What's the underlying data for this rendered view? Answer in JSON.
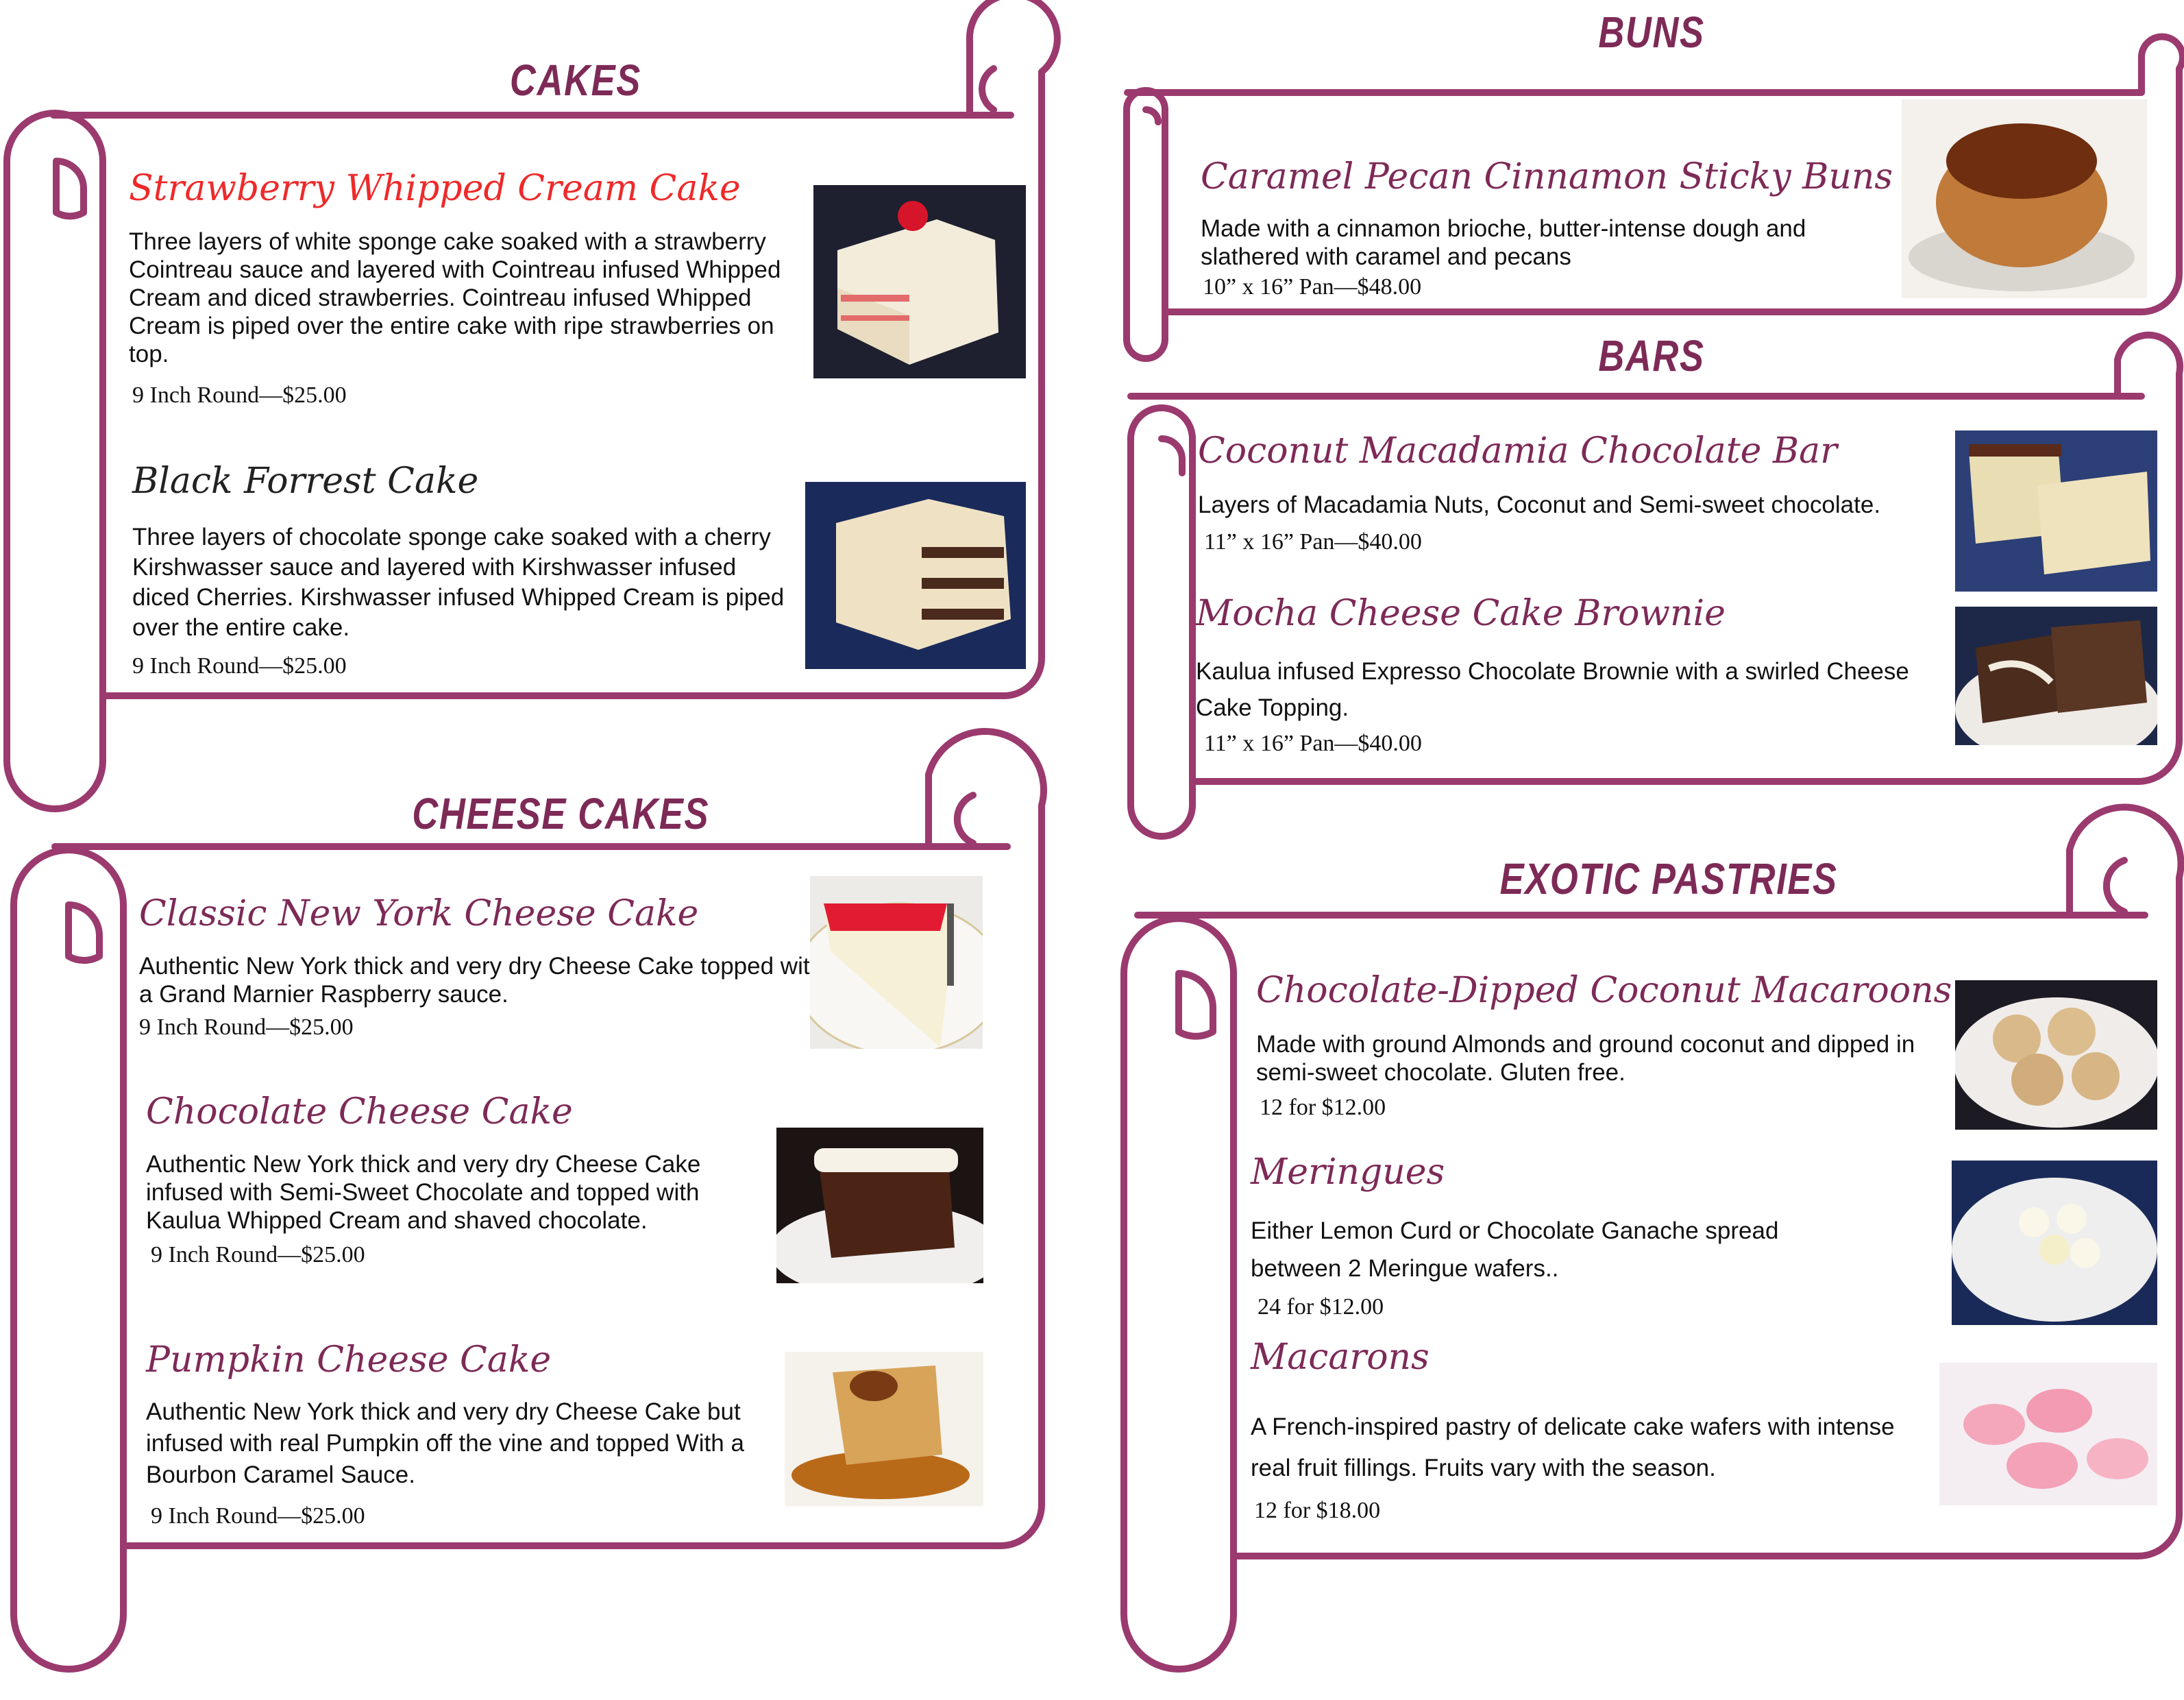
{
  "sections": {
    "cakes": {
      "title": "CAKES",
      "items": [
        {
          "name": "Strawberry Whipped Cream Cake",
          "description": "Three layers of white sponge cake soaked with a strawberry Cointreau sauce and layered with Cointreau infused Whipped Cream and diced strawberries. Cointreau infused Whipped Cream is piped over the entire cake with ripe strawberries on top.",
          "price": "9 Inch Round—$25.00"
        },
        {
          "name": "Black Forrest Cake",
          "description": "Three layers of chocolate sponge cake soaked with a cherry Kirshwasser sauce and layered with Kirshwasser infused diced Cherries. Kirshwasser infused Whipped Cream is piped over the entire cake.",
          "price": "9 Inch Round—$25.00"
        }
      ]
    },
    "cheese_cakes": {
      "title": "CHEESE CAKES",
      "items": [
        {
          "name": "Classic New York Cheese Cake",
          "description": "Authentic  New York thick and very dry Cheese Cake topped with a Grand Marnier Raspberry sauce.",
          "price": "9 Inch Round—$25.00"
        },
        {
          "name": "Chocolate Cheese Cake",
          "description": "Authentic  New York thick and very dry Cheese Cake infused with Semi-Sweet Chocolate and topped with Kaulua Whipped Cream and shaved chocolate.",
          "price": "9 Inch Round—$25.00"
        },
        {
          "name": "Pumpkin Cheese Cake",
          "description": "Authentic  New York thick and very dry Cheese Cake but infused with real Pumpkin off the vine and topped With a Bourbon Caramel Sauce.",
          "price": "9 Inch Round—$25.00"
        }
      ]
    },
    "buns": {
      "title": "BUNS",
      "items": [
        {
          "name": "Caramel Pecan Cinnamon Sticky Buns",
          "description": "Made with a cinnamon brioche, butter-intense dough and slathered with caramel and pecans",
          "price": "10” x 16” Pan—$48.00"
        }
      ]
    },
    "bars": {
      "title": "BARS",
      "items": [
        {
          "name": "Coconut Macadamia Chocolate Bar",
          "description": "Layers of Macadamia Nuts, Coconut and Semi-sweet chocolate.",
          "price": "11” x 16” Pan—$40.00"
        },
        {
          "name": "Mocha Cheese Cake Brownie",
          "description": "Kaulua infused Expresso Chocolate Brownie with a swirled Cheese Cake Topping.",
          "price": "11” x 16” Pan—$40.00"
        }
      ]
    },
    "exotic_pastries": {
      "title": "EXOTIC  PASTRIES",
      "items": [
        {
          "name": "Chocolate-Dipped Coconut Macaroons",
          "description": "Made with ground Almonds and ground coconut and dipped in semi-sweet chocolate.  Gluten free.",
          "price": "12 for $12.00"
        },
        {
          "name": "Meringues",
          "description": "Either Lemon Curd or Chocolate Ganache spread between 2 Meringue wafers..",
          "price": "24 for $12.00"
        },
        {
          "name": "Macarons",
          "description": "A French-inspired pastry of delicate cake wafers with intense real fruit fillings.  Fruits vary with the season.",
          "price": "12 for $18.00"
        }
      ]
    }
  },
  "colors": {
    "scroll_border": "#9b3a6e",
    "section_title": "#7d2a57",
    "item_name": "#7d2a57",
    "item_name_featured": "#ee2a2a"
  }
}
